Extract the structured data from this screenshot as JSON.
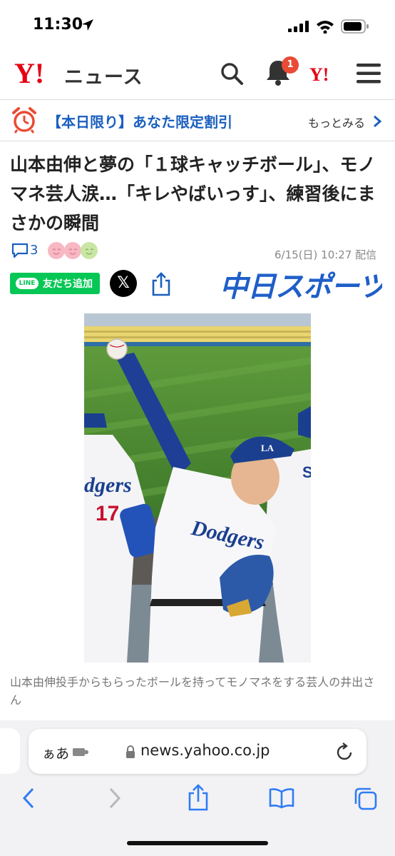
{
  "status_bar": {
    "time": "11:30"
  },
  "header": {
    "logo_text": "Y!",
    "brand": "ニュース",
    "notification_count": "1",
    "yj_text": "Y!"
  },
  "promo": {
    "text": "【本日限り】あなた限定割引",
    "more": "もっとみる"
  },
  "article": {
    "title": "山本由伸と夢の「１球キャッチボール」、モノマネ芸人涙…「キレやばいっす」、練習後にまさかの瞬間",
    "comment_count": "3",
    "date": "6/15(日) 10:27 配信",
    "source_logo": "中日スポーツ",
    "caption": "山本由伸投手からもらったボールを持ってモノマネをする芸人の井出さん"
  },
  "share": {
    "line_logo": "LINE",
    "line_label": "友だち追加",
    "x_label": "𝕏"
  },
  "photo": {
    "jersey_left_text": "dgers",
    "jersey_left_number": "17",
    "jersey_center_text": "Dodgers",
    "jersey_right_text": "S",
    "cap_letters": "LA"
  },
  "browser": {
    "aa_label": "ぁあ",
    "url": "news.yahoo.co.jp"
  },
  "colors": {
    "accent_blue": "#1a5fbf",
    "yahoo_red": "#e60012",
    "badge_red": "#e94b35",
    "line_green": "#06c755",
    "source_blue": "#1e5fc8"
  }
}
